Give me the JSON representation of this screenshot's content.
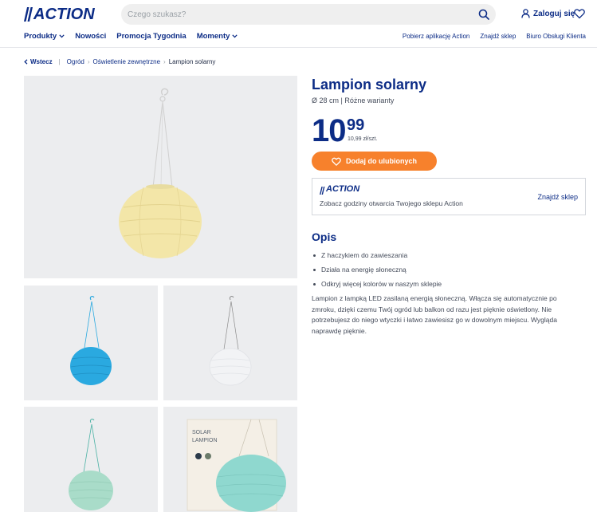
{
  "header": {
    "logo_text": "ACTION",
    "search_placeholder": "Czego szukasz?",
    "login_label": "Zaloguj się"
  },
  "nav": {
    "left": [
      {
        "label": "Produkty",
        "dropdown": true
      },
      {
        "label": "Nowości",
        "dropdown": false
      },
      {
        "label": "Promocja Tygodnia",
        "dropdown": false
      },
      {
        "label": "Momenty",
        "dropdown": true
      }
    ],
    "right": [
      "Pobierz aplikację Action",
      "Znajdź sklep",
      "Biuro Obsługi Klienta"
    ]
  },
  "breadcrumb": {
    "back_label": "Wstecz",
    "items": [
      "Ogród",
      "Oświetlenie zewnętrzne"
    ],
    "current": "Lampion solarny"
  },
  "gallery": {
    "main": {
      "lantern_color": "#f3e6a8",
      "alt": "yellow-lantern"
    },
    "thumbnails": [
      {
        "lantern_color": "#2aa9e0"
      },
      {
        "lantern_color": "#f2f3f5"
      },
      {
        "lantern_color": "#a9dcc9"
      },
      {
        "lantern_color": "#8fd8cf",
        "box_label_1": "SOLAR",
        "box_label_2": "LAMPION"
      }
    ]
  },
  "product": {
    "title": "Lampion solarny",
    "subtitle": "Ø 28 cm | Różne warianty",
    "price_int": "10",
    "price_cents": "99",
    "unit_price": "10,99 zł/szt.",
    "fav_button": "Dodaj do ulubionych"
  },
  "store": {
    "logo_text": "ACTION",
    "text": "Zobacz godziny otwarcia Twojego sklepu Action",
    "link": "Znajdź sklep"
  },
  "description": {
    "title": "Opis",
    "bullets": [
      "Z haczykiem do zawieszania",
      "Działa na energię słoneczną",
      "Odkryj więcej kolorów w naszym sklepie"
    ],
    "text": "Lampion z lampką LED zasilaną energią słoneczną. Włącza się automatycznie po zmroku, dzięki czemu Twój ogród lub balkon od razu jest pięknie oświetlony. Nie potrzebujesz do niego wtyczki i łatwo zawiesisz go w dowolnym miejscu. Wygląda naprawdę pięknie."
  },
  "colors": {
    "brand_blue": "#0c2c86",
    "accent_orange": "#f7812c"
  }
}
